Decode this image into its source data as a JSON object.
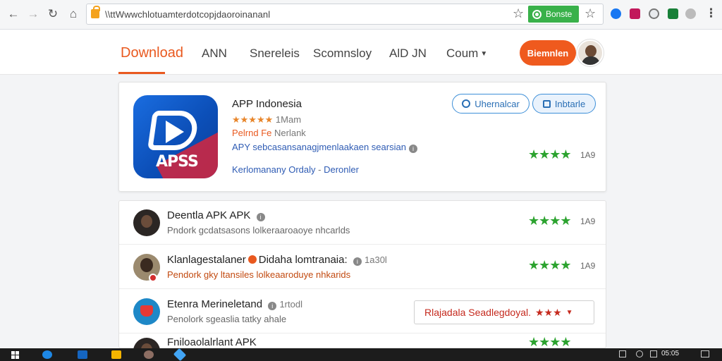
{
  "browser": {
    "url": "\\\\ttWwwchlotuamterdotcopjdaoroinananl",
    "extension_label": "Bonste"
  },
  "header": {
    "nav": [
      {
        "label": "Download",
        "active": true
      },
      {
        "label": "ANN",
        "active": false
      },
      {
        "label": "Snereleis",
        "active": false
      },
      {
        "label": "Scomnsloy",
        "active": false
      },
      {
        "label": "AlD JN",
        "active": false
      },
      {
        "label": "Coum",
        "active": false,
        "has_dropdown": true
      }
    ],
    "cta_label": "Biemnlen"
  },
  "app": {
    "icon_text": "APSS",
    "title": "APP Indonesia",
    "rating_stars": "★★★★★",
    "rating_count": "1Mam",
    "subtitle_highlight": "Pelrnd Fe",
    "subtitle_rest": "Nerlank",
    "description": "APY sebcasansanagjmenlaakaen searsian",
    "developer": "Kerlomanany Ordaly",
    "developer_separator": "-",
    "developer_link": "Deronler",
    "wishlist_label": "Uhernalcar",
    "share_label": "Inbtarle",
    "stars": "★★★★",
    "stars_count": "1A9"
  },
  "list": [
    {
      "title": "Deentla APK APK",
      "subtitle": "Pndork gcdatsasons lolkeraaroaoye nhcarlds",
      "stars": "★★★★",
      "count": "1A9"
    },
    {
      "title_a": "Klanlagestalaner",
      "title_b": "Didaha lomtranaia:",
      "meta": "1a30l",
      "subtitle": "Pendork gky ltansiles lolkeaaroduye nhkarids",
      "stars": "★★★★",
      "count": "1A9"
    },
    {
      "title": "Etenra Merineletand",
      "meta": "1rtodl",
      "subtitle": "Penolork sgeaslia tatky ahale",
      "select_label": "Rlajadala Seadlegdoyal.",
      "select_stars": "★★★"
    },
    {
      "title": "Fniloaolalrlant APK"
    }
  ],
  "taskbar": {
    "clock": "05:05"
  }
}
